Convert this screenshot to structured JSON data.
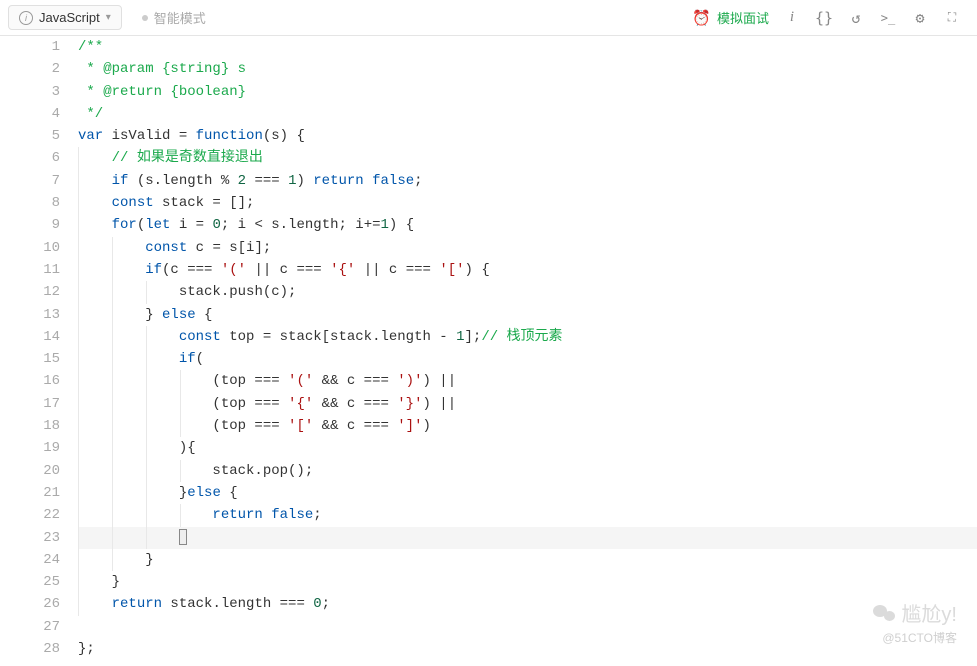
{
  "toolbar": {
    "language": "JavaScript",
    "smart_mode": "智能模式",
    "mock_interview": "模拟面试"
  },
  "watermark": {
    "name": "尴尬y!",
    "sub": "@51CTO博客"
  },
  "code": {
    "lines": [
      {
        "n": 1,
        "tokens": [
          [
            "comment",
            "/**"
          ]
        ]
      },
      {
        "n": 2,
        "tokens": [
          [
            "comment",
            " * @param {string} s"
          ]
        ]
      },
      {
        "n": 3,
        "tokens": [
          [
            "comment",
            " * @return {boolean}"
          ]
        ]
      },
      {
        "n": 4,
        "tokens": [
          [
            "comment",
            " */"
          ]
        ]
      },
      {
        "n": 5,
        "tokens": [
          [
            "keyword",
            "var"
          ],
          [
            "text",
            " isValid = "
          ],
          [
            "keyword",
            "function"
          ],
          [
            "text",
            "(s) {"
          ]
        ]
      },
      {
        "n": 6,
        "indent": 1,
        "tokens": [
          [
            "comment",
            "// 如果是奇数直接退出"
          ]
        ]
      },
      {
        "n": 7,
        "indent": 1,
        "tokens": [
          [
            "keyword",
            "if"
          ],
          [
            "text",
            " (s.length % "
          ],
          [
            "number",
            "2"
          ],
          [
            "text",
            " === "
          ],
          [
            "number",
            "1"
          ],
          [
            "text",
            ") "
          ],
          [
            "keyword",
            "return"
          ],
          [
            "text",
            " "
          ],
          [
            "builtin",
            "false"
          ],
          [
            "text",
            ";"
          ]
        ]
      },
      {
        "n": 8,
        "indent": 1,
        "tokens": [
          [
            "keyword",
            "const"
          ],
          [
            "text",
            " stack = [];"
          ]
        ]
      },
      {
        "n": 9,
        "indent": 1,
        "tokens": [
          [
            "keyword",
            "for"
          ],
          [
            "text",
            "("
          ],
          [
            "keyword",
            "let"
          ],
          [
            "text",
            " i = "
          ],
          [
            "number",
            "0"
          ],
          [
            "text",
            "; i < s.length; i+="
          ],
          [
            "number",
            "1"
          ],
          [
            "text",
            ") {"
          ]
        ]
      },
      {
        "n": 10,
        "indent": 2,
        "tokens": [
          [
            "keyword",
            "const"
          ],
          [
            "text",
            " c = s[i];"
          ]
        ]
      },
      {
        "n": 11,
        "indent": 2,
        "tokens": [
          [
            "keyword",
            "if"
          ],
          [
            "text",
            "(c === "
          ],
          [
            "string",
            "'('"
          ],
          [
            "text",
            " || c === "
          ],
          [
            "string",
            "'{'"
          ],
          [
            "text",
            " || c === "
          ],
          [
            "string",
            "'['"
          ],
          [
            "text",
            ") {"
          ]
        ]
      },
      {
        "n": 12,
        "indent": 3,
        "tokens": [
          [
            "text",
            "stack.push(c);"
          ]
        ]
      },
      {
        "n": 13,
        "indent": 2,
        "tokens": [
          [
            "text",
            "} "
          ],
          [
            "keyword",
            "else"
          ],
          [
            "text",
            " {"
          ]
        ]
      },
      {
        "n": 14,
        "indent": 3,
        "tokens": [
          [
            "keyword",
            "const"
          ],
          [
            "text",
            " top = stack[stack.length - "
          ],
          [
            "number",
            "1"
          ],
          [
            "text",
            "];"
          ],
          [
            "comment",
            "// 栈顶元素"
          ]
        ]
      },
      {
        "n": 15,
        "indent": 3,
        "tokens": [
          [
            "keyword",
            "if"
          ],
          [
            "text",
            "("
          ]
        ]
      },
      {
        "n": 16,
        "indent": 4,
        "tokens": [
          [
            "text",
            "(top === "
          ],
          [
            "string",
            "'('"
          ],
          [
            "text",
            " && c === "
          ],
          [
            "string",
            "')'"
          ],
          [
            "text",
            ") ||"
          ]
        ]
      },
      {
        "n": 17,
        "indent": 4,
        "tokens": [
          [
            "text",
            "(top === "
          ],
          [
            "string",
            "'{'"
          ],
          [
            "text",
            " && c === "
          ],
          [
            "string",
            "'}'"
          ],
          [
            "text",
            ") ||"
          ]
        ]
      },
      {
        "n": 18,
        "indent": 4,
        "tokens": [
          [
            "text",
            "(top === "
          ],
          [
            "string",
            "'['"
          ],
          [
            "text",
            " && c === "
          ],
          [
            "string",
            "']'"
          ],
          [
            "text",
            ")"
          ]
        ]
      },
      {
        "n": 19,
        "indent": 3,
        "tokens": [
          [
            "text",
            "){"
          ]
        ]
      },
      {
        "n": 20,
        "indent": 4,
        "tokens": [
          [
            "text",
            "stack.pop();"
          ]
        ]
      },
      {
        "n": 21,
        "indent": 3,
        "tokens": [
          [
            "text",
            "}"
          ],
          [
            "keyword",
            "else"
          ],
          [
            "text",
            " {"
          ]
        ]
      },
      {
        "n": 22,
        "indent": 4,
        "tokens": [
          [
            "keyword",
            "return"
          ],
          [
            "text",
            " "
          ],
          [
            "builtin",
            "false"
          ],
          [
            "text",
            ";"
          ]
        ]
      },
      {
        "n": 23,
        "indent": 3,
        "highlight": true,
        "tokens": [
          [
            "cursor",
            "}"
          ]
        ]
      },
      {
        "n": 24,
        "indent": 2,
        "tokens": [
          [
            "text",
            "}"
          ]
        ]
      },
      {
        "n": 25,
        "indent": 1,
        "tokens": [
          [
            "text",
            "}"
          ]
        ]
      },
      {
        "n": 26,
        "indent": 1,
        "tokens": [
          [
            "keyword",
            "return"
          ],
          [
            "text",
            " stack.length === "
          ],
          [
            "number",
            "0"
          ],
          [
            "text",
            ";"
          ]
        ]
      },
      {
        "n": 27,
        "tokens": []
      },
      {
        "n": 28,
        "tokens": [
          [
            "text",
            "};"
          ]
        ]
      }
    ]
  }
}
